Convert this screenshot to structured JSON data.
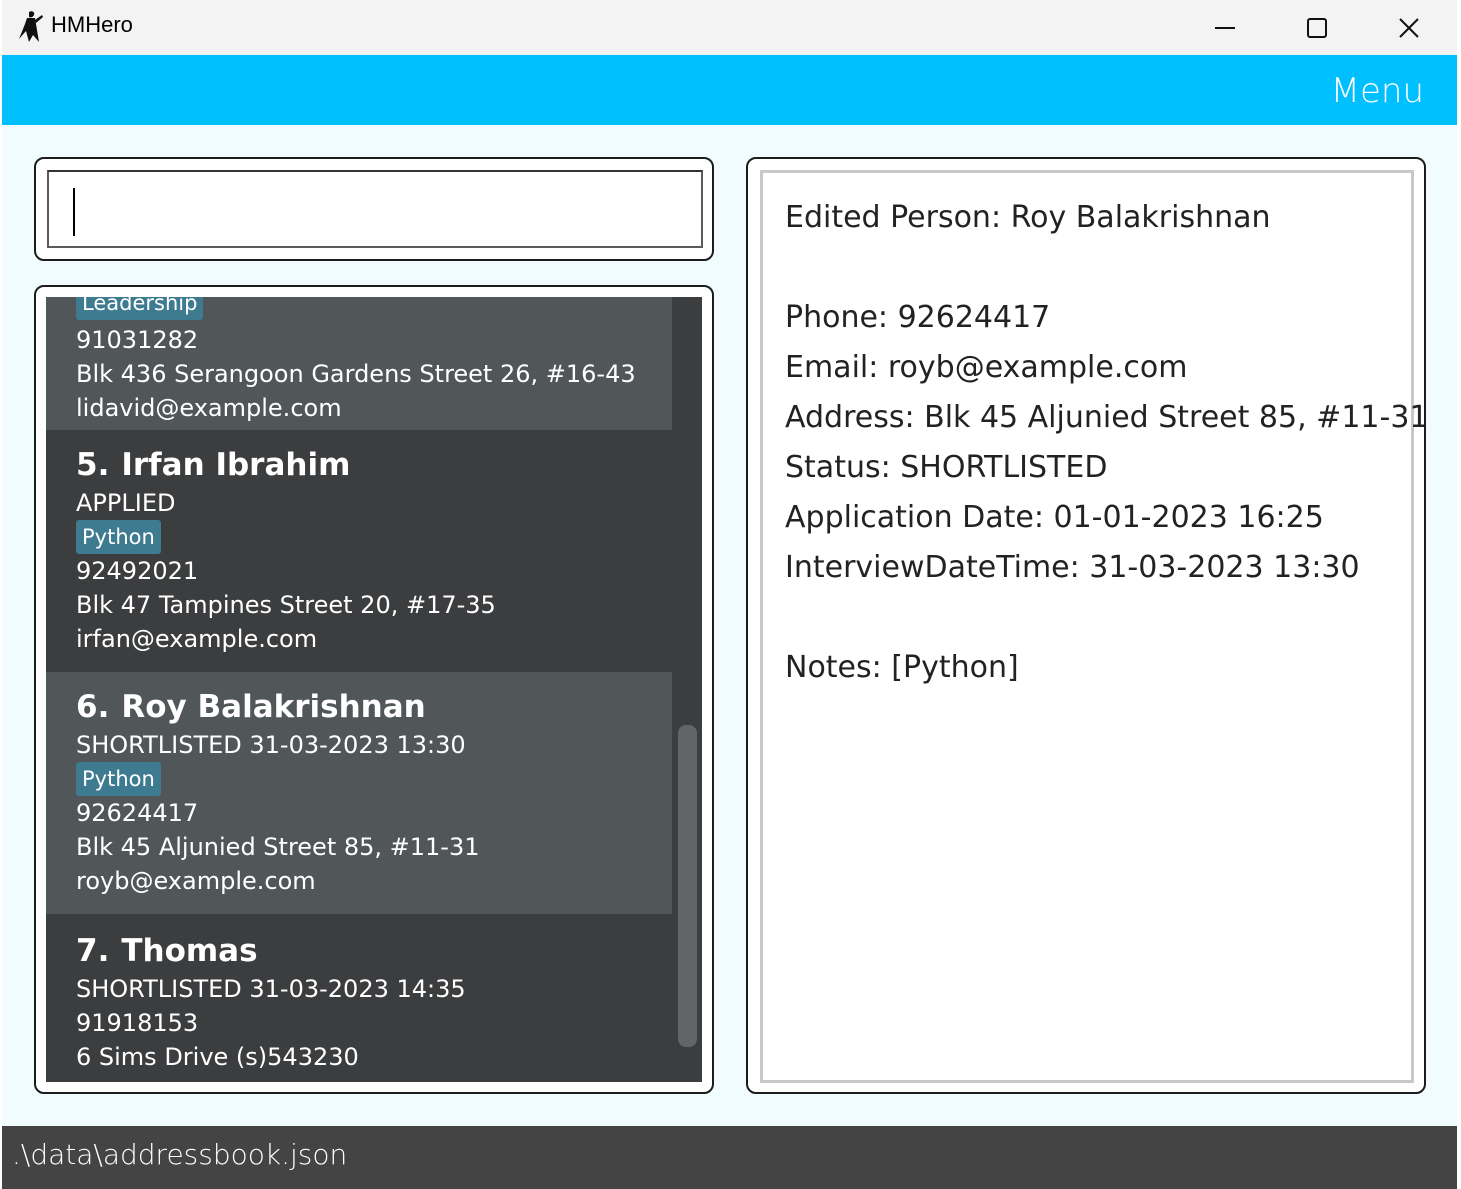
{
  "window": {
    "title": "HMHero",
    "controls": [
      "minimize-icon",
      "maximize-icon",
      "close-icon"
    ]
  },
  "menubar": {
    "menu_label": "Menu"
  },
  "command_box": {
    "value": ""
  },
  "person_list": {
    "items": [
      {
        "index": "",
        "name": "",
        "status": "",
        "tag": "Leadership",
        "phone": "91031282",
        "address": "Blk 436 Serangoon Gardens Street 26, #16-43",
        "email": "lidavid@example.com"
      },
      {
        "index": "5.",
        "name": "Irfan Ibrahim",
        "status": "APPLIED",
        "tag": "Python",
        "phone": "92492021",
        "address": "Blk 47 Tampines Street 20, #17-35",
        "email": "irfan@example.com"
      },
      {
        "index": "6.",
        "name": "Roy Balakrishnan",
        "status": "SHORTLISTED 31-03-2023 13:30",
        "tag": "Python",
        "phone": "92624417",
        "address": "Blk 45 Aljunied Street 85, #11-31",
        "email": "royb@example.com"
      },
      {
        "index": "7.",
        "name": "Thomas",
        "status": "SHORTLISTED 31-03-2023 14:35",
        "tag": "",
        "phone": "91918153",
        "address": "6 Sims Drive (s)543230",
        "email": ""
      }
    ]
  },
  "result_display": {
    "lines": [
      "Edited Person: Roy Balakrishnan",
      "",
      "Phone: 92624417",
      "Email: royb@example.com",
      "Address: Blk 45 Aljunied Street 85, #11-31",
      "Status: SHORTLISTED",
      "Application Date: 01-01-2023 16:25",
      "InterviewDateTime: 31-03-2023 13:30",
      "",
      "Notes: [Python]"
    ]
  },
  "statusbar": {
    "path": ".\\data\\addressbook.json"
  },
  "colors": {
    "menubar": "#00bfff",
    "list_bg": "#3c3d3f",
    "list_selected": "#515658",
    "tag": "#3e7b91",
    "statusbar": "#444444"
  }
}
